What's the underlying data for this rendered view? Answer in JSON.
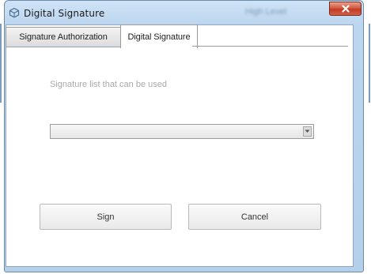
{
  "window": {
    "title": "Digital Signature",
    "title_blurred": "High Level",
    "icon": "app-icon",
    "close_icon": "close-icon"
  },
  "tabs": [
    {
      "label": "Signature Authorization",
      "active": false
    },
    {
      "label": "Digital Signature",
      "active": true
    }
  ],
  "panel": {
    "list_label": "Signature list that can be used",
    "select_value": "",
    "select_arrow_icon": "chevron-down-icon"
  },
  "buttons": {
    "sign_label": "Sign",
    "cancel_label": "Cancel"
  },
  "colors": {
    "frame": "#b3cfea",
    "close": "#c23a22",
    "muted_text": "#a9a9a9"
  }
}
